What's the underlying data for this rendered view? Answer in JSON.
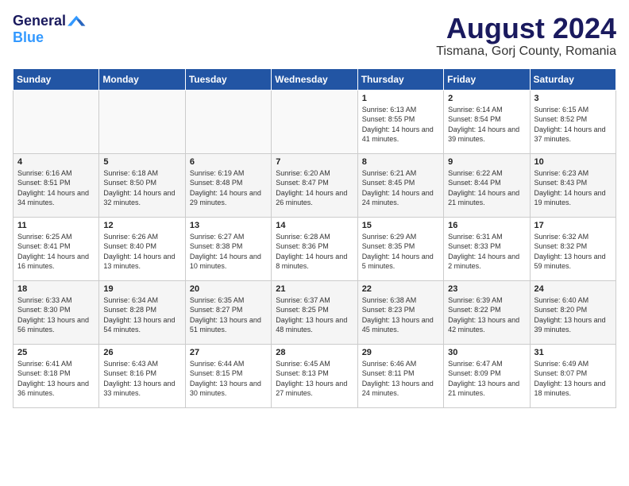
{
  "logo": {
    "general": "General",
    "blue": "Blue"
  },
  "title": {
    "month": "August 2024",
    "location": "Tismana, Gorj County, Romania"
  },
  "days_of_week": [
    "Sunday",
    "Monday",
    "Tuesday",
    "Wednesday",
    "Thursday",
    "Friday",
    "Saturday"
  ],
  "weeks": [
    [
      {
        "day": "",
        "sunrise": "",
        "sunset": "",
        "daylight": ""
      },
      {
        "day": "",
        "sunrise": "",
        "sunset": "",
        "daylight": ""
      },
      {
        "day": "",
        "sunrise": "",
        "sunset": "",
        "daylight": ""
      },
      {
        "day": "",
        "sunrise": "",
        "sunset": "",
        "daylight": ""
      },
      {
        "day": "1",
        "sunrise": "6:13 AM",
        "sunset": "8:55 PM",
        "daylight": "14 hours and 41 minutes."
      },
      {
        "day": "2",
        "sunrise": "6:14 AM",
        "sunset": "8:54 PM",
        "daylight": "14 hours and 39 minutes."
      },
      {
        "day": "3",
        "sunrise": "6:15 AM",
        "sunset": "8:52 PM",
        "daylight": "14 hours and 37 minutes."
      }
    ],
    [
      {
        "day": "4",
        "sunrise": "6:16 AM",
        "sunset": "8:51 PM",
        "daylight": "14 hours and 34 minutes."
      },
      {
        "day": "5",
        "sunrise": "6:18 AM",
        "sunset": "8:50 PM",
        "daylight": "14 hours and 32 minutes."
      },
      {
        "day": "6",
        "sunrise": "6:19 AM",
        "sunset": "8:48 PM",
        "daylight": "14 hours and 29 minutes."
      },
      {
        "day": "7",
        "sunrise": "6:20 AM",
        "sunset": "8:47 PM",
        "daylight": "14 hours and 26 minutes."
      },
      {
        "day": "8",
        "sunrise": "6:21 AM",
        "sunset": "8:45 PM",
        "daylight": "14 hours and 24 minutes."
      },
      {
        "day": "9",
        "sunrise": "6:22 AM",
        "sunset": "8:44 PM",
        "daylight": "14 hours and 21 minutes."
      },
      {
        "day": "10",
        "sunrise": "6:23 AM",
        "sunset": "8:43 PM",
        "daylight": "14 hours and 19 minutes."
      }
    ],
    [
      {
        "day": "11",
        "sunrise": "6:25 AM",
        "sunset": "8:41 PM",
        "daylight": "14 hours and 16 minutes."
      },
      {
        "day": "12",
        "sunrise": "6:26 AM",
        "sunset": "8:40 PM",
        "daylight": "14 hours and 13 minutes."
      },
      {
        "day": "13",
        "sunrise": "6:27 AM",
        "sunset": "8:38 PM",
        "daylight": "14 hours and 10 minutes."
      },
      {
        "day": "14",
        "sunrise": "6:28 AM",
        "sunset": "8:36 PM",
        "daylight": "14 hours and 8 minutes."
      },
      {
        "day": "15",
        "sunrise": "6:29 AM",
        "sunset": "8:35 PM",
        "daylight": "14 hours and 5 minutes."
      },
      {
        "day": "16",
        "sunrise": "6:31 AM",
        "sunset": "8:33 PM",
        "daylight": "14 hours and 2 minutes."
      },
      {
        "day": "17",
        "sunrise": "6:32 AM",
        "sunset": "8:32 PM",
        "daylight": "13 hours and 59 minutes."
      }
    ],
    [
      {
        "day": "18",
        "sunrise": "6:33 AM",
        "sunset": "8:30 PM",
        "daylight": "13 hours and 56 minutes."
      },
      {
        "day": "19",
        "sunrise": "6:34 AM",
        "sunset": "8:28 PM",
        "daylight": "13 hours and 54 minutes."
      },
      {
        "day": "20",
        "sunrise": "6:35 AM",
        "sunset": "8:27 PM",
        "daylight": "13 hours and 51 minutes."
      },
      {
        "day": "21",
        "sunrise": "6:37 AM",
        "sunset": "8:25 PM",
        "daylight": "13 hours and 48 minutes."
      },
      {
        "day": "22",
        "sunrise": "6:38 AM",
        "sunset": "8:23 PM",
        "daylight": "13 hours and 45 minutes."
      },
      {
        "day": "23",
        "sunrise": "6:39 AM",
        "sunset": "8:22 PM",
        "daylight": "13 hours and 42 minutes."
      },
      {
        "day": "24",
        "sunrise": "6:40 AM",
        "sunset": "8:20 PM",
        "daylight": "13 hours and 39 minutes."
      }
    ],
    [
      {
        "day": "25",
        "sunrise": "6:41 AM",
        "sunset": "8:18 PM",
        "daylight": "13 hours and 36 minutes."
      },
      {
        "day": "26",
        "sunrise": "6:43 AM",
        "sunset": "8:16 PM",
        "daylight": "13 hours and 33 minutes."
      },
      {
        "day": "27",
        "sunrise": "6:44 AM",
        "sunset": "8:15 PM",
        "daylight": "13 hours and 30 minutes."
      },
      {
        "day": "28",
        "sunrise": "6:45 AM",
        "sunset": "8:13 PM",
        "daylight": "13 hours and 27 minutes."
      },
      {
        "day": "29",
        "sunrise": "6:46 AM",
        "sunset": "8:11 PM",
        "daylight": "13 hours and 24 minutes."
      },
      {
        "day": "30",
        "sunrise": "6:47 AM",
        "sunset": "8:09 PM",
        "daylight": "13 hours and 21 minutes."
      },
      {
        "day": "31",
        "sunrise": "6:49 AM",
        "sunset": "8:07 PM",
        "daylight": "13 hours and 18 minutes."
      }
    ]
  ],
  "labels": {
    "sunrise": "Sunrise:",
    "sunset": "Sunset:",
    "daylight": "Daylight:"
  }
}
